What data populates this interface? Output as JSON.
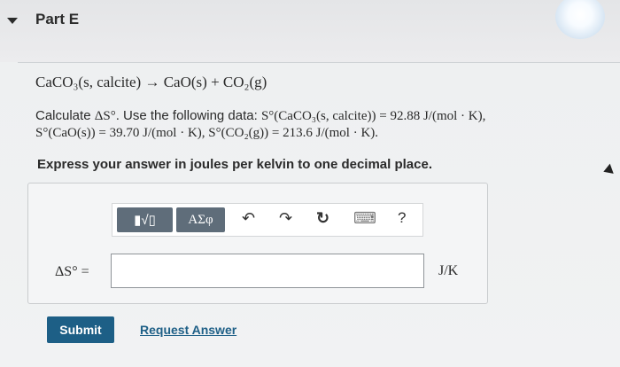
{
  "part": {
    "title": "Part E"
  },
  "question": {
    "equation": "CaCO₃(s, calcite) → CaO(s) + CO₂(g)",
    "prompt_line1_prefix": "Calculate ",
    "prompt_line1_var": "ΔS°",
    "prompt_line1_mid": ". Use the following data: ",
    "prompt_line1_data": "S°(CaCO₃(s, calcite)) = 92.88 J/(mol · K),",
    "prompt_line2": "S°(CaO(s)) = 39.70 J/(mol · K), S°(CO₂(g)) = 213.6 J/(mol · K).",
    "instructions": "Express your answer in joules per kelvin to one decimal place."
  },
  "toolbar": {
    "templates_label": "▮√▯",
    "symbols_label": "ΑΣφ",
    "undo_glyph": "↶",
    "redo_glyph": "↷",
    "reset_glyph": "↻",
    "keyboard_glyph": "⌨",
    "help_label": "?"
  },
  "answer": {
    "label": "ΔS° =",
    "value": "",
    "unit": "J/K"
  },
  "actions": {
    "submit_label": "Submit",
    "request_answer_label": "Request Answer"
  },
  "colors": {
    "submit_bg": "#1d5f86",
    "toolbar_button_bg": "#5f6d7a",
    "link": "#1d5f86"
  }
}
